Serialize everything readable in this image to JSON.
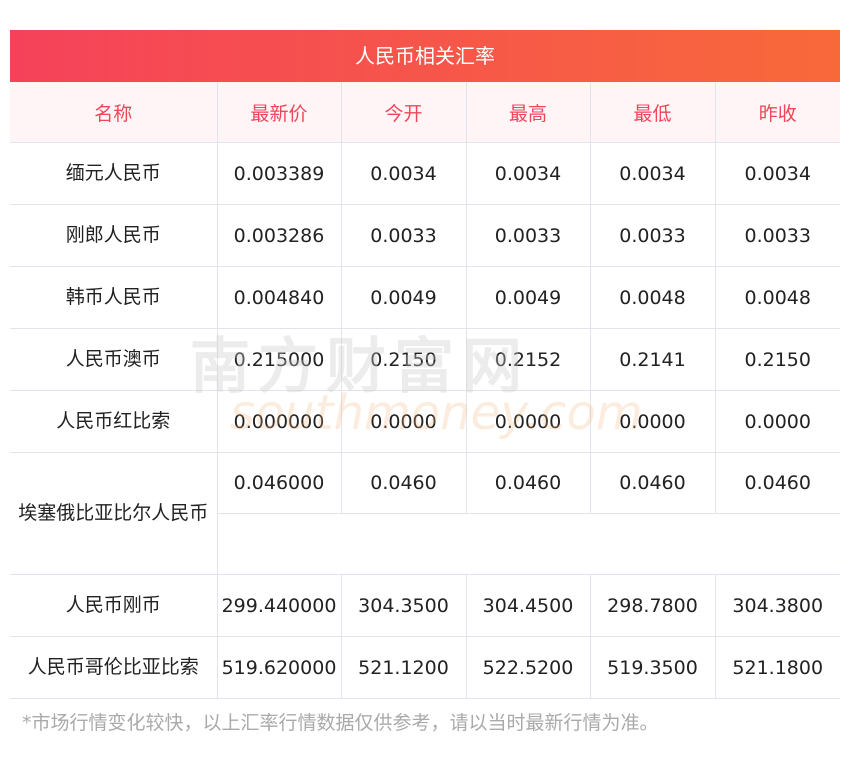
{
  "title": "人民币相关汇率",
  "headers": [
    "名称",
    "最新价",
    "今开",
    "最高",
    "最低",
    "昨收"
  ],
  "rows": [
    [
      "缅元人民币",
      "0.003389",
      "0.0034",
      "0.0034",
      "0.0034",
      "0.0034"
    ],
    [
      "刚郎人民币",
      "0.003286",
      "0.0033",
      "0.0033",
      "0.0033",
      "0.0033"
    ],
    [
      "韩币人民币",
      "0.004840",
      "0.0049",
      "0.0049",
      "0.0048",
      "0.0048"
    ],
    [
      "人民币澳币",
      "0.215000",
      "0.2150",
      "0.2152",
      "0.2141",
      "0.2150"
    ],
    [
      "人民币红比索",
      "0.000000",
      "0.0000",
      "0.0000",
      "0.0000",
      "0.0000"
    ],
    [
      "埃塞俄比亚比尔人民币",
      "0.046000",
      "0.0460",
      "0.0460",
      "0.0460",
      "0.0460"
    ],
    [
      "人民币刚币",
      "299.440000",
      "304.3500",
      "304.4500",
      "298.7800",
      "304.3800"
    ],
    [
      "人民币哥伦比亚比索",
      "519.620000",
      "521.1200",
      "522.5200",
      "519.3500",
      "521.1800"
    ]
  ],
  "watermark": {
    "cn": "南方财富网",
    "en": "southmoney.com"
  },
  "note": "*市场行情变化较快，以上汇率行情数据仅供参考，请以当时最新行情为准。"
}
